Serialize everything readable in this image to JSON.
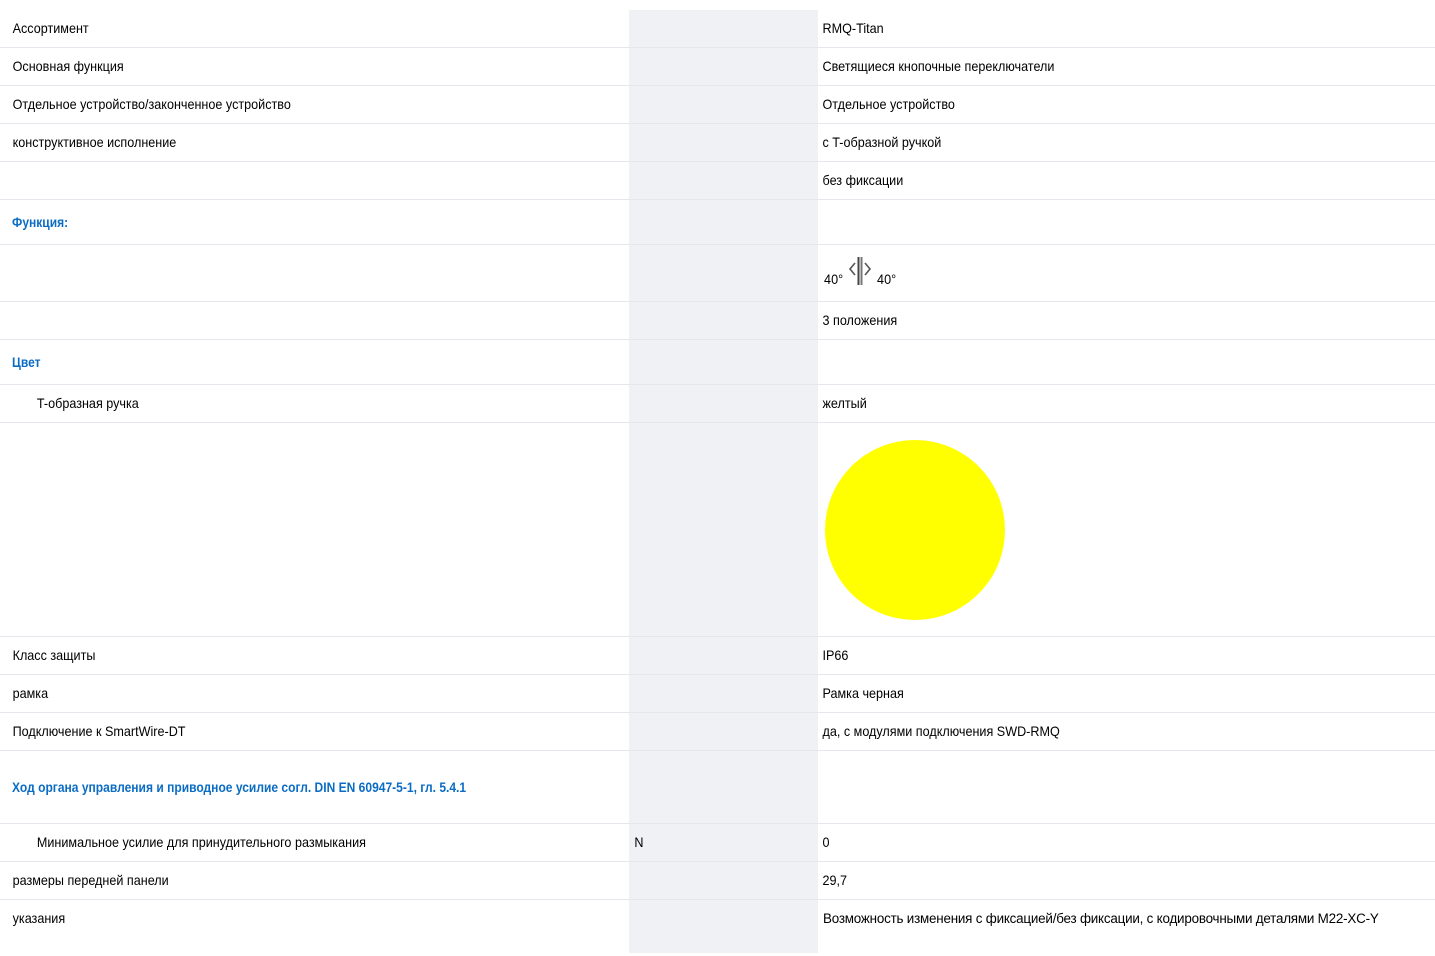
{
  "rows": [
    {
      "label": "Ассортимент",
      "unit": "",
      "value": "RMQ-Titan"
    },
    {
      "label": "Основная функция",
      "unit": "",
      "value": "Светящиеся кнопочные переключатели"
    },
    {
      "label": "Отдельное устройство/законченное устройство",
      "unit": "",
      "value": "Отдельное устройство"
    },
    {
      "label": "конструктивное исполнение",
      "unit": "",
      "value": "с T-образной ручкой"
    },
    {
      "label": "",
      "unit": "",
      "value": "без фиксации"
    }
  ],
  "function_section": {
    "title": "Функция:",
    "symbol": {
      "left_angle": "40°",
      "right_angle": "40°",
      "icon": "rotary-switch-icon"
    },
    "positions": "3 положения"
  },
  "color_section": {
    "title": "Цвет",
    "handle_label": "T-образная ручка",
    "handle_value": "желтый",
    "swatch_color": "#ffff00"
  },
  "rows2": [
    {
      "label": "Класс защиты",
      "unit": "",
      "value": "IP66"
    },
    {
      "label": "рамка",
      "unit": "",
      "value": "Рамка черная"
    },
    {
      "label": "Подключение к SmartWire-DT",
      "unit": "",
      "value": "да, с модулями подключения SWD-RMQ"
    }
  ],
  "travel_section": {
    "title": "Ход органа управления и приводное усилие согл. DIN EN 60947-5-1, гл. 5.4.1",
    "min_force_label": "Минимальное усилие для принудительного размыкания",
    "min_force_unit": "N",
    "min_force_value": "0"
  },
  "rows3": [
    {
      "label": "размеры передней панели",
      "unit": "",
      "value": "29,7"
    },
    {
      "label": "указания",
      "unit": "",
      "value": "Возможность изменения с фиксацией/без фиксации, с кодировочными деталями M22-XC-Y"
    }
  ],
  "colors": {
    "accent": "#0b6cc4",
    "unit_column_bg": "#eff1f5",
    "divider": "#e4e7ec"
  }
}
